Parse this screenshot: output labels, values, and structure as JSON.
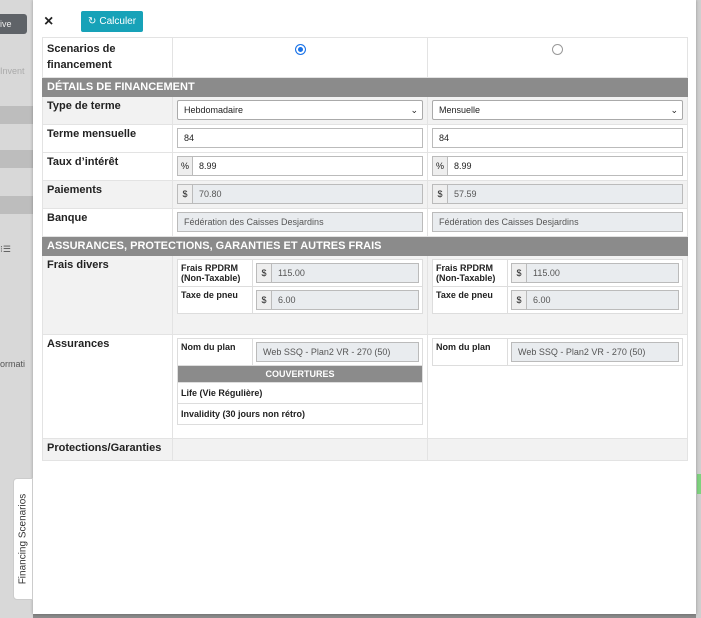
{
  "background": {
    "top_button": "ive",
    "faded_text": "Invent",
    "side_text": "ormati"
  },
  "side_tab": {
    "label": "Financing Scenarios"
  },
  "modal": {
    "close_symbol": "×",
    "calc_icon": "↻",
    "calc_label": "Calculer"
  },
  "rows": {
    "scenarios_label": "Scenarios de financement",
    "section_details": "DÉTAILS DE FINANCEMENT",
    "type_label": "Type de terme",
    "terme_label": "Terme mensuelle",
    "taux_label": "Taux d’intérêt",
    "paiements_label": "Paiements",
    "banque_label": "Banque",
    "section_assurances": "ASSURANCES, PROTECTIONS, GARANTIES ET AUTRES FRAIS",
    "frais_label": "Frais divers",
    "assurances_label": "Assurances",
    "protections_label": "Protections/Garanties"
  },
  "symbols": {
    "percent": "%",
    "dollar": "$",
    "chevron": "⌄"
  },
  "sub_labels": {
    "rpdrm_l1": "Frais RPDRM",
    "rpdrm_l2": "(Non-Taxable)",
    "pneu": "Taxe de pneu",
    "plan": "Nom du plan",
    "couvertures": "COUVERTURES"
  },
  "scenarios": [
    {
      "selected": true,
      "type": "Hebdomadaire",
      "terme": "84",
      "taux": "8.99",
      "paiement": "70.80",
      "banque": "Fédération des Caisses Desjardins",
      "rpdrm": "115.00",
      "pneu": "6.00",
      "plan": "Web SSQ - Plan2 VR - 270 (50)",
      "couvertures": [
        "Life (Vie Régulière)",
        "Invalidity (30 jours non rétro)"
      ]
    },
    {
      "selected": false,
      "type": "Mensuelle",
      "terme": "84",
      "taux": "8.99",
      "paiement": "57.59",
      "banque": "Fédération des Caisses Desjardins",
      "rpdrm": "115.00",
      "pneu": "6.00",
      "plan": "Web SSQ - Plan2 VR - 270 (50)"
    }
  ]
}
